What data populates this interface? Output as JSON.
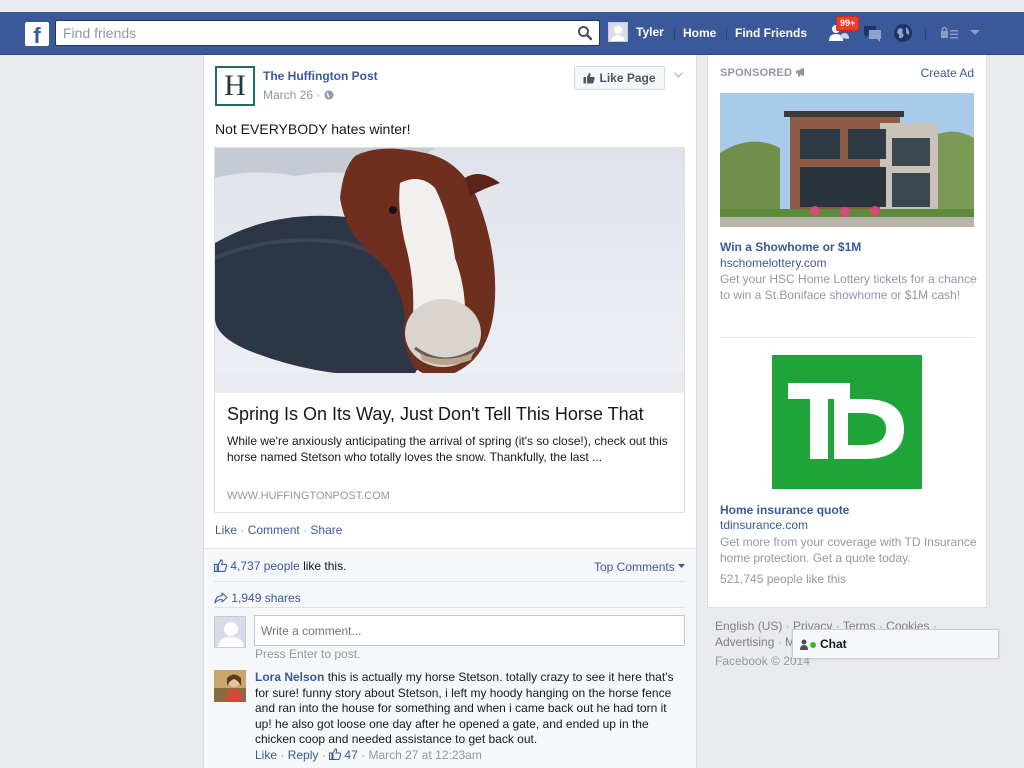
{
  "topbar": {
    "search_placeholder": "Find friends",
    "user_name": "Tyler",
    "home": "Home",
    "find_friends": "Find Friends",
    "friend_badge": "99+",
    "brand_color": "#3b5998"
  },
  "post": {
    "page_name": "The Huffington Post",
    "logo_letter": "H",
    "date": "March 26 ·",
    "like_page": "Like Page",
    "text": "Not EVERYBODY hates winter!",
    "link": {
      "title": "Spring Is On Its Way, Just Don't Tell This Horse That",
      "description": "While we're anxiously anticipating the arrival of spring (it's so close!), check out this horse named Stetson who totally loves the snow. Thankfully, the last ...",
      "source": "WWW.HUFFINGTONPOST.COM"
    },
    "actions": {
      "like": "Like",
      "comment": "Comment",
      "share": "Share",
      "sep": "·"
    },
    "likes_count": "4,737 people",
    "likes_suffix": " like this.",
    "top_comments": "Top Comments",
    "shares": "1,949 shares",
    "comment_placeholder": "Write a comment...",
    "press_enter": "Press Enter to post.",
    "comment": {
      "author": "Lora Nelson",
      "text": " this is actually my horse Stetson. totally crazy to see it here that's for sure! funny story about Stetson, i left my hoody hanging on the horse fence and ran into the house for something and when i came back out he had torn it up! he also got loose one day after he opened a gate, and ended up in the chicken coop and needed assistance to get back out.",
      "like": "Like",
      "reply": "Reply",
      "like_count": "47",
      "time": "· March 27 at 12:23am"
    }
  },
  "sidebar": {
    "sponsored": "SPONSORED",
    "create_ad": "Create Ad",
    "ads": [
      {
        "title": "Win a Showhome or $1M",
        "domain": "hschomelottery.com",
        "description": "Get your HSC Home Lottery tickets for a chance to win a St.Boniface showhome or $1M cash!"
      },
      {
        "title": "Home insurance quote",
        "domain": "tdinsurance.com",
        "description": "Get more from your coverage with TD Insurance home protection. Get a quote today.",
        "likes": "521,745 people like this",
        "logo_text": "TD",
        "logo_color": "#1fa43a"
      }
    ]
  },
  "footer": {
    "english": "English (US)",
    "privacy": "Privacy",
    "terms": "Terms",
    "cookies": "Cookies",
    "advertising": "Advertising",
    "more": "M",
    "copyright": "Facebook © 2014"
  },
  "chat": {
    "label": "Chat"
  }
}
